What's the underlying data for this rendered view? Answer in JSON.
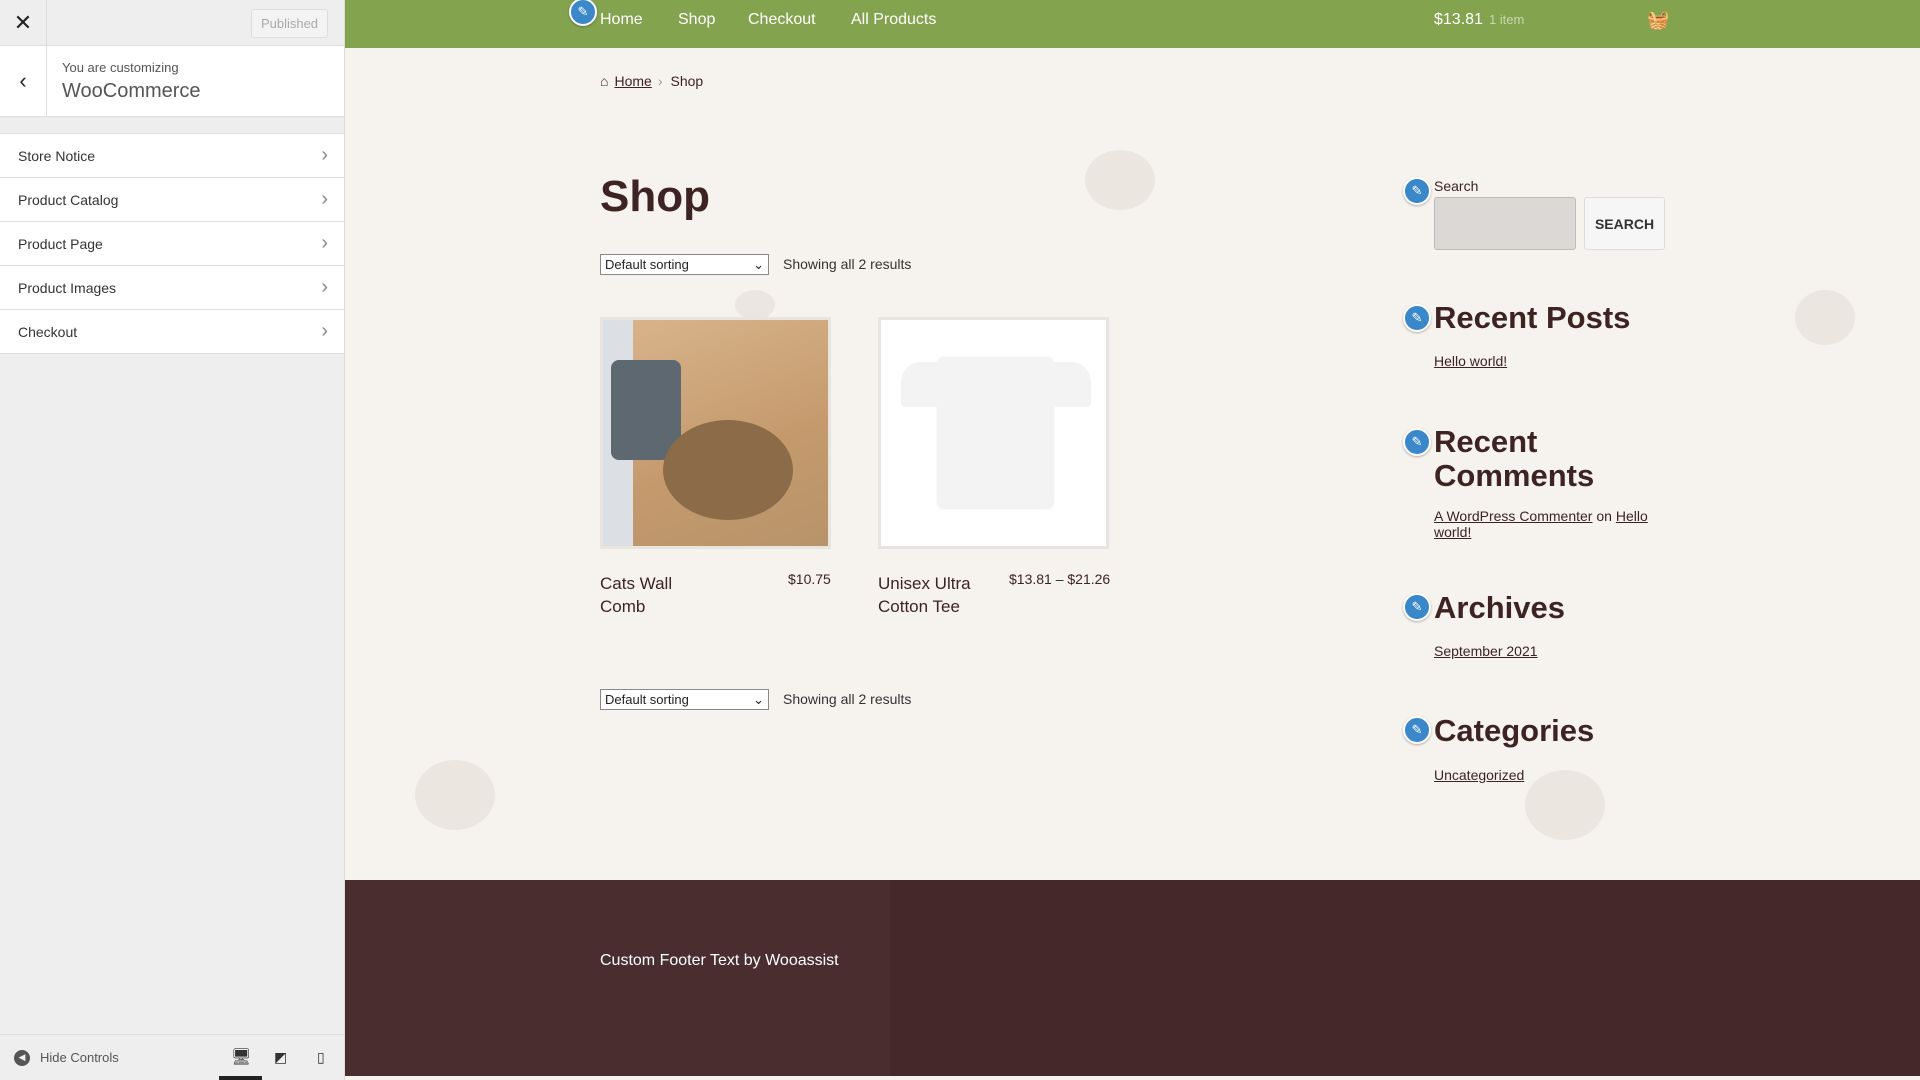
{
  "customizer": {
    "close_icon": "close-icon",
    "publish_label": "Published",
    "customizing_label": "You are customizing",
    "panel_title": "WooCommerce",
    "sections": [
      {
        "label": "Store Notice"
      },
      {
        "label": "Product Catalog"
      },
      {
        "label": "Product Page"
      },
      {
        "label": "Product Images"
      },
      {
        "label": "Checkout"
      }
    ],
    "hide_controls": "Hide Controls",
    "devices": [
      "desktop",
      "tablet",
      "mobile"
    ],
    "active_device": "desktop"
  },
  "site": {
    "colors": {
      "header": "#84a34f",
      "background": "#f6f3ef",
      "text": "#3d2322",
      "footer": "#45282a",
      "edit_shortcut": "#3a87c9"
    },
    "nav": [
      {
        "label": "Home"
      },
      {
        "label": "Shop"
      },
      {
        "label": "Checkout"
      },
      {
        "label": "All Products"
      }
    ],
    "cart": {
      "total": "$13.81",
      "items": "1 item"
    },
    "breadcrumb": {
      "home": "Home",
      "current": "Shop"
    },
    "title": "Shop",
    "sorting": {
      "selected": "Default sorting",
      "result_count": "Showing all 2 results"
    },
    "products": [
      {
        "name": "Cats Wall Comb",
        "price": "$10.75"
      },
      {
        "name": "Unisex Ultra Cotton Tee",
        "price": "$13.81 – $21.26"
      }
    ],
    "widgets": {
      "search_label": "Search",
      "search_button": "SEARCH",
      "search_value": "",
      "recent_posts_title": "Recent Posts",
      "recent_posts": [
        "Hello world!"
      ],
      "recent_comments_title": "Recent Comments",
      "comment_author": "A WordPress Commenter",
      "comment_on": "on",
      "comment_post": "Hello world!",
      "archives_title": "Archives",
      "archives": [
        "September 2021"
      ],
      "categories_title": "Categories",
      "categories": [
        "Uncategorized"
      ]
    },
    "footer_text": "Custom Footer Text by Wooassist"
  }
}
